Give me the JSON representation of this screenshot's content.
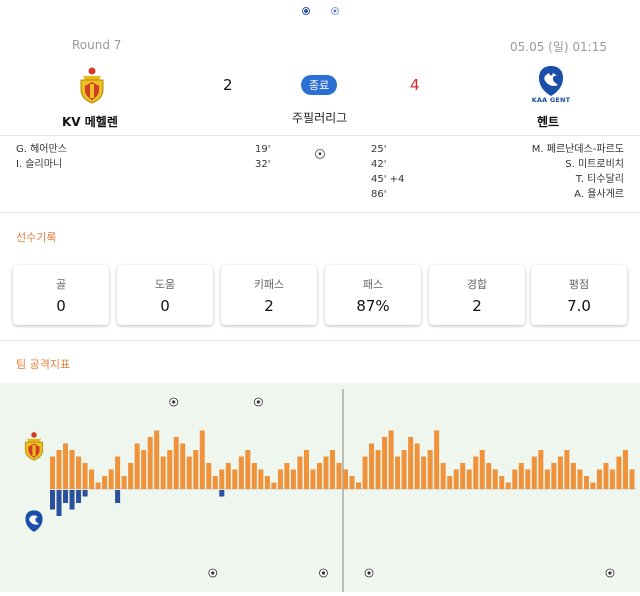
{
  "pagination": {
    "pages": 2,
    "active": 0
  },
  "match": {
    "round": "Round 7",
    "datetime": "05.05 (일) 01:15",
    "status": "종료",
    "league": "주필러리그",
    "home": {
      "name": "KV 메헬렌",
      "score": "2",
      "logo": "mechelen-crest-icon",
      "color": "#e8c020"
    },
    "away": {
      "name": "헨트",
      "score": "4",
      "logo": "gent-crest-icon",
      "logo_text": "KAA GENT",
      "color": "#1a4ea8"
    }
  },
  "goals": {
    "icon": "soccer-ball-icon",
    "home": [
      {
        "player": "G. 헤어만스",
        "minute": "19'"
      },
      {
        "player": "I. 슬리마니",
        "minute": "32'"
      }
    ],
    "away": [
      {
        "player": "M. 페르난데스-파르도",
        "minute": "25'"
      },
      {
        "player": "S. 미트로비치",
        "minute": "42'"
      },
      {
        "player": "T. 티수달리",
        "minute": "45' +4"
      },
      {
        "player": "A. 욜사게르",
        "minute": "86'"
      }
    ]
  },
  "player_record": {
    "title": "선수기록",
    "stats": [
      {
        "label": "골",
        "value": "0"
      },
      {
        "label": "도움",
        "value": "0"
      },
      {
        "label": "키패스",
        "value": "2"
      },
      {
        "label": "패스",
        "value": "87%"
      },
      {
        "label": "경합",
        "value": "2"
      },
      {
        "label": "평점",
        "value": "7.0"
      }
    ]
  },
  "attack_index": {
    "title": "팀 공격지표",
    "colors": {
      "home": "#f0923a",
      "away": "#2a4f9c",
      "background": "#eef6ee"
    },
    "chart_data": {
      "type": "bar",
      "series": [
        {
          "values": [
            5,
            6,
            7,
            6,
            5,
            4,
            3,
            1,
            2,
            3,
            5,
            2,
            4,
            7,
            6,
            8,
            9,
            5,
            6,
            8,
            7,
            5,
            6,
            9,
            4,
            2,
            3,
            4,
            3,
            5,
            6,
            4,
            3,
            2,
            1,
            3,
            4,
            3,
            5,
            6,
            3,
            4,
            5,
            6,
            4,
            3,
            2,
            1,
            5,
            7,
            6,
            8,
            9,
            5,
            6,
            8,
            7,
            5,
            6,
            9,
            4,
            2,
            3,
            4,
            3,
            5,
            6,
            4,
            3,
            2,
            1,
            3,
            4,
            3,
            5,
            6,
            3,
            4,
            5,
            6,
            4,
            3,
            2,
            1,
            3,
            4,
            3,
            5,
            6,
            3
          ]
        },
        {
          "values": [
            3,
            4,
            2,
            3,
            2,
            1,
            0,
            0,
            0,
            0,
            2,
            0,
            0,
            0,
            0,
            0,
            0,
            0,
            0,
            0,
            0,
            0,
            0,
            0,
            0,
            0,
            1,
            0,
            0,
            0,
            0,
            0,
            0,
            0,
            0,
            0,
            0,
            0,
            0,
            0,
            0,
            0,
            0,
            0,
            0,
            0,
            0,
            0,
            0,
            0,
            0,
            0,
            0,
            0,
            0,
            0,
            0,
            0,
            0,
            0,
            0,
            0,
            0,
            0,
            0,
            0,
            0,
            0,
            0,
            0,
            0,
            0,
            0,
            0,
            0,
            0,
            0,
            0,
            0,
            0,
            0,
            0,
            0,
            0,
            0,
            0,
            0,
            0,
            0,
            0
          ]
        }
      ],
      "markers": {
        "home_goal_minutes": [
          19,
          32
        ],
        "away_goal_minutes": [
          25,
          42,
          49,
          86
        ]
      }
    }
  }
}
